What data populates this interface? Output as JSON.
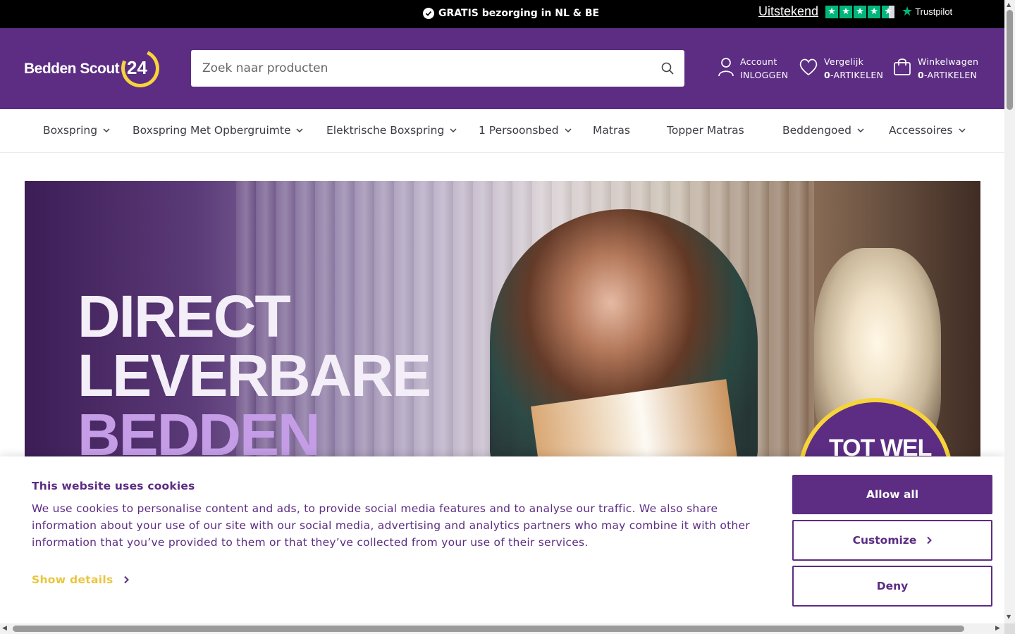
{
  "topbar": {
    "promo_text": "GRATIS bezorging in NL & BE",
    "trust_rating_label": "Uitstekend",
    "trust_stars": 4.5,
    "trust_brand": "Trustpilot"
  },
  "header": {
    "logo_text": "Bedden Scout",
    "logo_number": "24",
    "search_placeholder": "Zoek naar producten",
    "account": {
      "label": "Account",
      "sub": "INLOGGEN"
    },
    "compare": {
      "label": "Vergelijk",
      "count": "0",
      "sub": "-ARTIKELEN"
    },
    "cart": {
      "label": "Winkelwagen",
      "count": "0",
      "sub": "-ARTIKELEN"
    }
  },
  "nav": {
    "items": [
      {
        "label": "Boxspring",
        "dropdown": true
      },
      {
        "label": "Boxspring Met Opbergruimte",
        "dropdown": true
      },
      {
        "label": "Elektrische Boxspring",
        "dropdown": true
      },
      {
        "label": "1 Persoonsbed",
        "dropdown": true
      },
      {
        "label": "Matras",
        "dropdown": false
      },
      {
        "label": "Topper Matras",
        "dropdown": false
      },
      {
        "label": "Beddengoed",
        "dropdown": true
      },
      {
        "label": "Accessoires",
        "dropdown": true
      }
    ]
  },
  "hero": {
    "line1": "DIRECT",
    "line2": "LEVERBARE",
    "line3": "BEDDEN",
    "badge": "TOT WEL"
  },
  "cookie": {
    "title": "This website uses cookies",
    "body": "We use cookies to personalise content and ads, to provide social media features and to analyse our traffic. We also share information about your use of our site with our social media, advertising and analytics partners who may combine it with other information that you’ve provided to them or that they’ve collected from your use of their services.",
    "details_label": "Show details",
    "allow_label": "Allow all",
    "customize_label": "Customize",
    "deny_label": "Deny"
  },
  "colors": {
    "brand_purple": "#5c2d83",
    "accent_yellow": "#f7d43a",
    "trustpilot_green": "#00b67a"
  }
}
